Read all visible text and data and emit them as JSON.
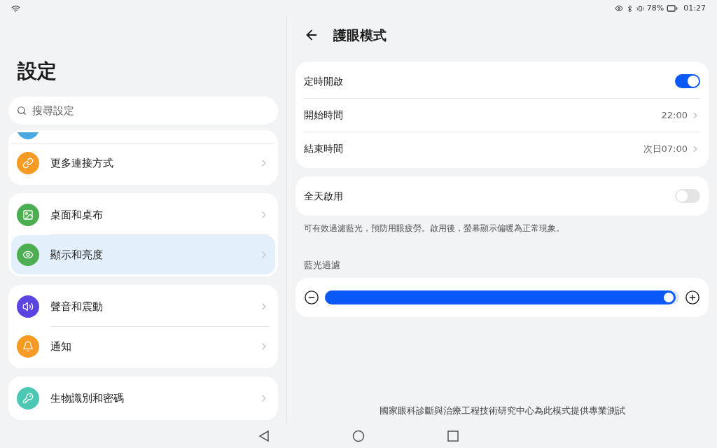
{
  "status_bar": {
    "battery": "78%",
    "time": "01:27"
  },
  "sidebar": {
    "title": "設定",
    "search": {
      "placeholder": "搜尋設定"
    },
    "groups": [
      {
        "partial_item": {
          "color": "#4aa8e0"
        },
        "items": [
          {
            "label": "更多連接方式",
            "color": "#f59a23",
            "selected": false
          }
        ]
      },
      {
        "items": [
          {
            "label": "桌面和桌布",
            "color": "#4cae50",
            "selected": false
          },
          {
            "label": "顯示和亮度",
            "color": "#4cae50",
            "selected": true
          }
        ]
      },
      {
        "items": [
          {
            "label": "聲音和震動",
            "color": "#5a45e0",
            "selected": false
          },
          {
            "label": "通知",
            "color": "#f59a23",
            "selected": false
          }
        ]
      },
      {
        "items": [
          {
            "label": "生物識別和密碼",
            "color": "#4cc7b4",
            "selected": false
          }
        ]
      }
    ]
  },
  "detail": {
    "title": "護眼模式",
    "schedule_card": [
      {
        "kind": "toggle",
        "label": "定時開啟",
        "on": true
      },
      {
        "kind": "value",
        "label": "開始時間",
        "value": "22:00"
      },
      {
        "kind": "value",
        "label": "結束時間",
        "value": "次日07:00"
      }
    ],
    "all_day": {
      "label": "全天啟用",
      "on": false
    },
    "description": "可有效過濾藍光，預防用眼疲勞。啟用後，螢幕顯示偏暖為正常現象。",
    "filter": {
      "label": "藍光過濾",
      "level": 0.99
    },
    "footer": "國家眼科診斷與治療工程技術研究中心為此模式提供專業測試"
  }
}
